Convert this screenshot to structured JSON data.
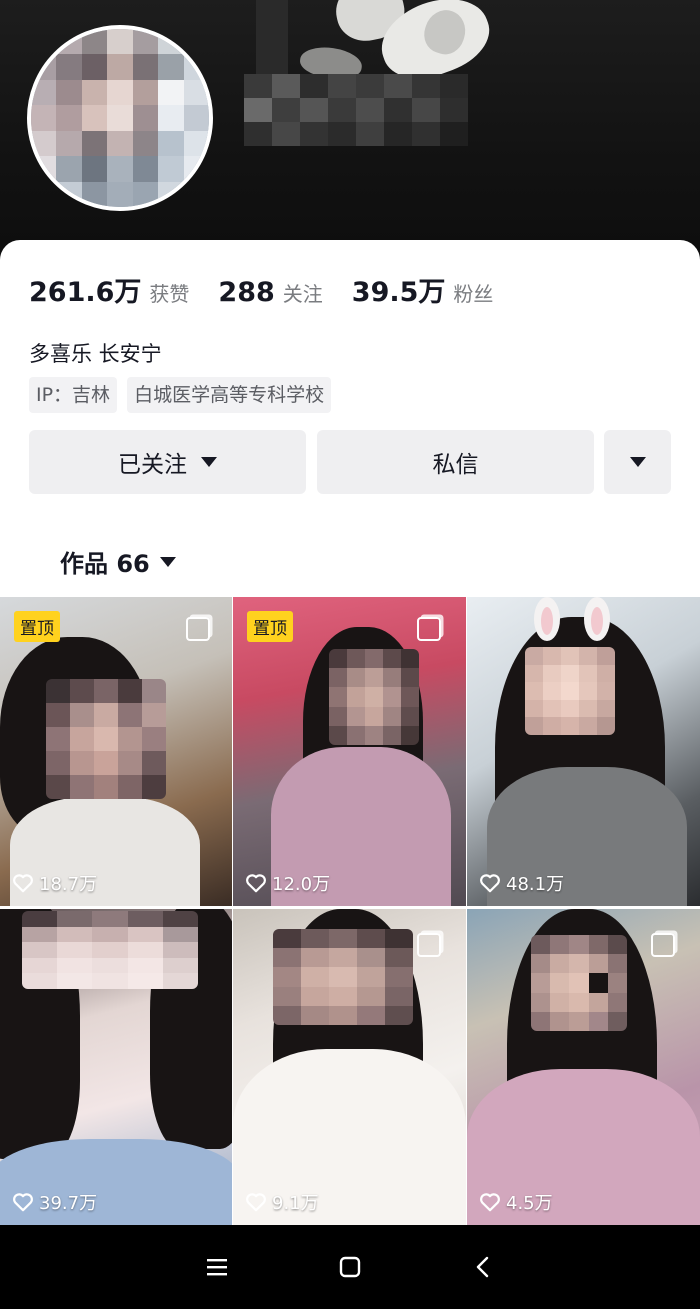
{
  "profile": {
    "stats": [
      {
        "value": "261.6万",
        "label": "获赞"
      },
      {
        "value": "288",
        "label": "关注"
      },
      {
        "value": "39.5万",
        "label": "粉丝"
      }
    ],
    "bio": "多喜乐 长安宁",
    "tags": [
      "IP：吉林",
      "白城医学高等专科学校"
    ],
    "buttons": {
      "follow": "已关注",
      "message": "私信"
    }
  },
  "tabs": {
    "works_label": "作品 66"
  },
  "posts": [
    {
      "likes": "18.7万",
      "pinned_label": "置顶",
      "pinned": true,
      "multi": true
    },
    {
      "likes": "12.0万",
      "pinned_label": "置顶",
      "pinned": true,
      "multi": true
    },
    {
      "likes": "48.1万",
      "pinned": false,
      "multi": false
    },
    {
      "likes": "39.7万",
      "pinned": false,
      "multi": false
    },
    {
      "likes": "9.1万",
      "pinned": false,
      "multi": true
    },
    {
      "likes": "4.5万",
      "pinned": false,
      "multi": true
    }
  ],
  "icons": {
    "like": "heart-outline-icon",
    "multi_image": "multi-image-icon",
    "nav": [
      "menu-icon",
      "home-square-icon",
      "back-chevron-icon"
    ]
  },
  "colors": {
    "pin_badge": "#ffd21e",
    "text_primary": "#161823",
    "text_secondary": "#7a7c80",
    "button_bg": "#efeff1"
  }
}
